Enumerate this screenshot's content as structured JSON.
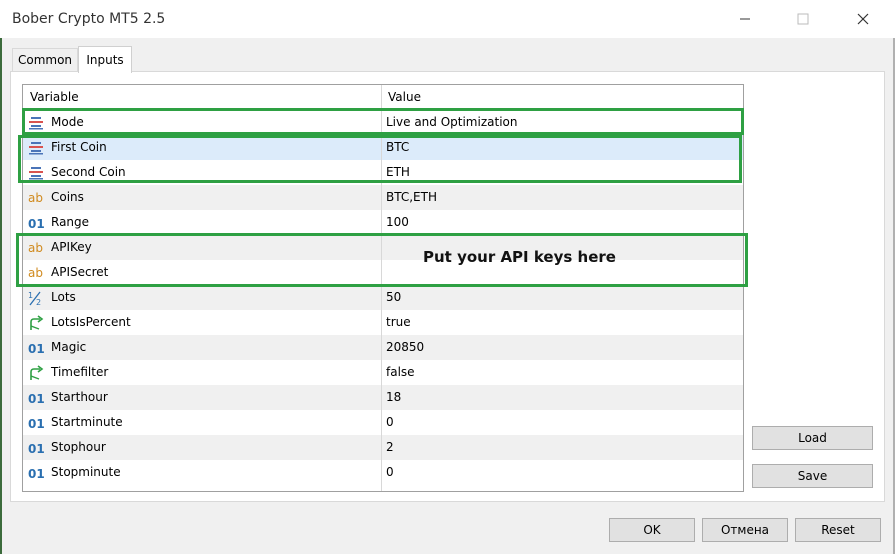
{
  "window": {
    "title": "Bober Crypto MT5 2.5"
  },
  "tabs": [
    {
      "label": "Common"
    },
    {
      "label": "Inputs"
    }
  ],
  "grid": {
    "headers": {
      "variable": "Variable",
      "value": "Value"
    },
    "rows": [
      {
        "name": "Mode",
        "value": "Live and Optimization",
        "icon": "enum-icon"
      },
      {
        "name": "First Coin",
        "value": "BTC",
        "icon": "enum-icon"
      },
      {
        "name": "Second Coin",
        "value": "ETH",
        "icon": "enum-icon"
      },
      {
        "name": "Coins",
        "value": "BTC,ETH",
        "icon": "string-icon"
      },
      {
        "name": "Range",
        "value": "100",
        "icon": "integer-icon"
      },
      {
        "name": "APIKey",
        "value": "",
        "icon": "string-icon"
      },
      {
        "name": "APISecret",
        "value": "",
        "icon": "string-icon"
      },
      {
        "name": "Lots",
        "value": "50",
        "icon": "fraction-icon"
      },
      {
        "name": "LotsIsPercent",
        "value": "true",
        "icon": "bool-arrow-icon"
      },
      {
        "name": "Magic",
        "value": "20850",
        "icon": "integer-icon"
      },
      {
        "name": "Timefilter",
        "value": "false",
        "icon": "bool-arrow-icon"
      },
      {
        "name": "Starthour",
        "value": "18",
        "icon": "integer-icon"
      },
      {
        "name": "Startminute",
        "value": "0",
        "icon": "integer-icon"
      },
      {
        "name": "Stophour",
        "value": "2",
        "icon": "integer-icon"
      },
      {
        "name": "Stopminute",
        "value": "0",
        "icon": "integer-icon"
      }
    ]
  },
  "annotation": {
    "text": "Put your API keys here",
    "color": "#2ea043"
  },
  "side_buttons": {
    "load": "Load",
    "save": "Save"
  },
  "footer_buttons": {
    "ok": "OK",
    "cancel": "Отмена",
    "reset": "Reset"
  }
}
